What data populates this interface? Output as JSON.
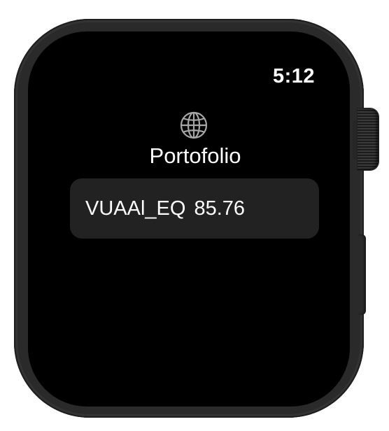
{
  "status_bar": {
    "time": "5:12"
  },
  "header": {
    "icon": "globe-icon",
    "title": "Portofolio"
  },
  "holdings": [
    {
      "symbol": "VUAAl_EQ",
      "price": "85.76"
    }
  ],
  "colors": {
    "background": "#000000",
    "card": "#222222",
    "text": "#ffffff",
    "case": "#2a2a2a"
  }
}
